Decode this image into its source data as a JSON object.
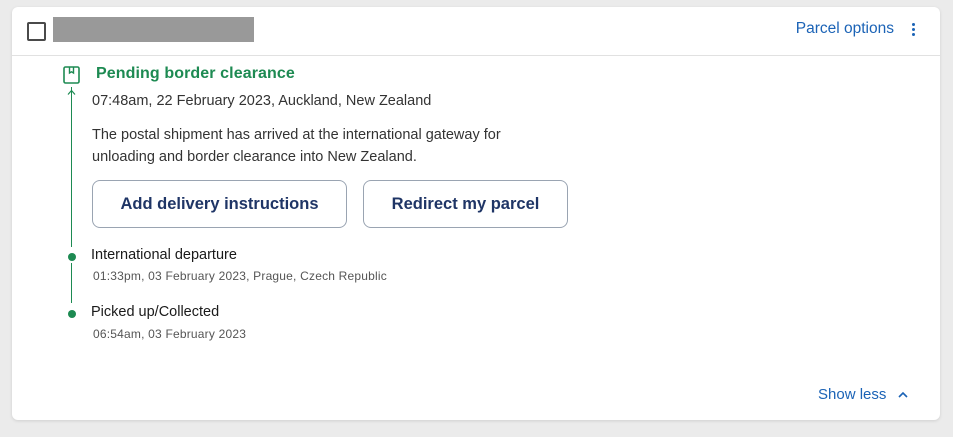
{
  "header": {
    "parcel_options_label": "Parcel options"
  },
  "current_status": {
    "title": "Pending border clearance",
    "timestamp_location": "07:48am, 22 February 2023, Auckland, New Zealand",
    "description": "The postal shipment has arrived at the international gateway for unloading and border clearance into New Zealand."
  },
  "actions": {
    "add_delivery_instructions": "Add delivery instructions",
    "redirect_parcel": "Redirect my parcel"
  },
  "events": [
    {
      "title": "International departure",
      "detail": "01:33pm, 03 February 2023, Prague, Czech Republic"
    },
    {
      "title": "Picked up/Collected",
      "detail": "06:54am, 03 February 2023"
    }
  ],
  "footer": {
    "show_less_label": "Show less"
  },
  "icons": {
    "status": "parcel-box-icon",
    "options": "kebab-menu-icon",
    "collapse": "chevron-up-icon"
  },
  "colors": {
    "accent_green": "#1d8a52",
    "link_blue": "#1b63b6",
    "button_text": "#1f3566"
  }
}
